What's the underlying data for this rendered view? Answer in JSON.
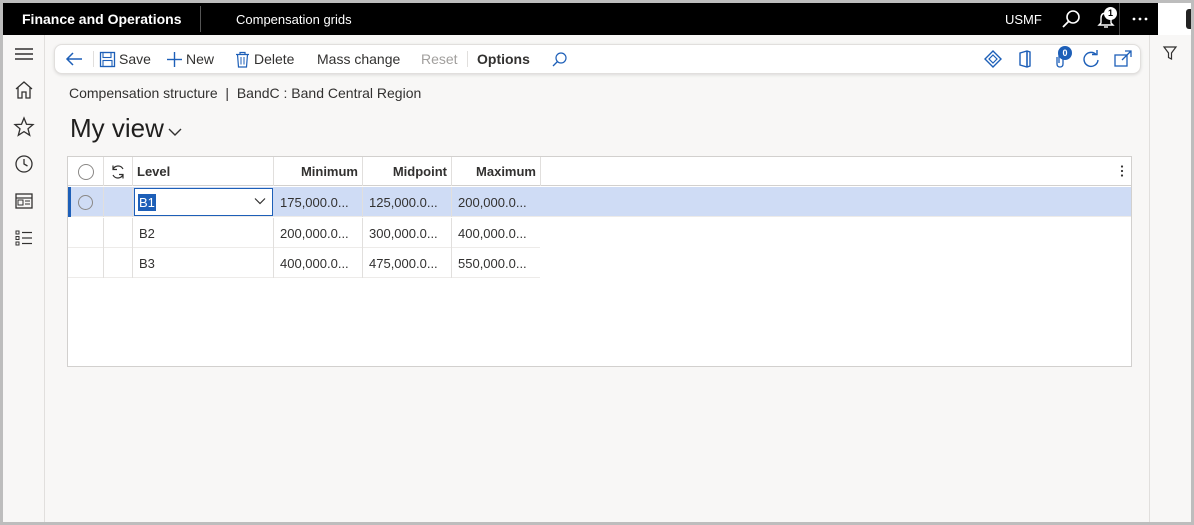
{
  "topbar": {
    "app_title": "Finance and Operations",
    "page_name": "Compensation grids",
    "company": "USMF",
    "notifications_count": "1"
  },
  "action_pane": {
    "save": "Save",
    "new": "New",
    "delete": "Delete",
    "mass_change": "Mass change",
    "reset": "Reset",
    "options": "Options",
    "attachments_count": "0"
  },
  "breadcrumb": "Compensation structure  |  BandC : Band Central Region",
  "view": {
    "title": "My view"
  },
  "grid": {
    "columns": {
      "level": "Level",
      "minimum": "Minimum",
      "midpoint": "Midpoint",
      "maximum": "Maximum"
    },
    "rows": [
      {
        "level": "B1",
        "minimum": "175,000.0...",
        "midpoint": "125,000.0...",
        "maximum": "200,000.0..."
      },
      {
        "level": "B2",
        "minimum": "200,000.0...",
        "midpoint": "300,000.0...",
        "maximum": "400,000.0..."
      },
      {
        "level": "B3",
        "minimum": "400,000.0...",
        "midpoint": "475,000.0...",
        "maximum": "550,000.0..."
      }
    ]
  },
  "colors": {
    "accent": "#1d5fb8",
    "selected_row": "#cfdcf5",
    "topbar": "#000000"
  }
}
